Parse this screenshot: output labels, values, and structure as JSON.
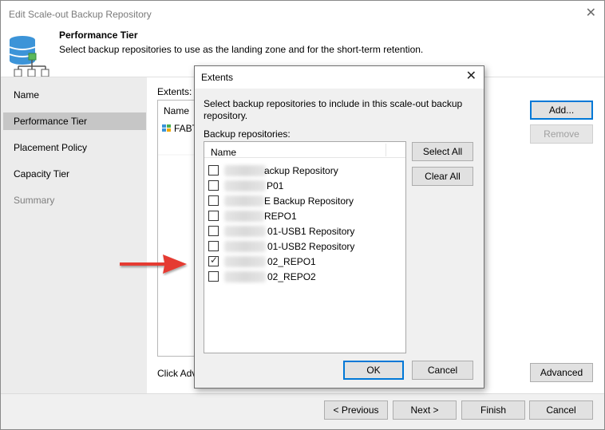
{
  "window": {
    "title": "Edit Scale-out Backup Repository",
    "close_glyph": "✕"
  },
  "header": {
    "title": "Performance Tier",
    "description": "Select backup repositories to use as the landing zone and for the short-term retention.",
    "icon": "database-repository-icon"
  },
  "sidebar": {
    "items": [
      {
        "label": "Name",
        "state": "normal"
      },
      {
        "label": "Performance Tier",
        "state": "active"
      },
      {
        "label": "Placement Policy",
        "state": "normal"
      },
      {
        "label": "Capacity Tier",
        "state": "normal"
      },
      {
        "label": "Summary",
        "state": "disabled"
      }
    ]
  },
  "main": {
    "extents_label": "Extents:",
    "list": {
      "column": "Name",
      "rows": [
        {
          "text": "FABT",
          "icon": "repository-icon"
        }
      ]
    },
    "click_hint": "Click Adv",
    "add_button": "Add...",
    "remove_button": "Remove",
    "advanced_button": "Advanced"
  },
  "footer": {
    "previous": "< Previous",
    "next": "Next >",
    "finish": "Finish",
    "cancel": "Cancel"
  },
  "dialog": {
    "title": "Extents",
    "close_glyph": "✕",
    "description": "Select backup repositories to include in this scale-out backup repository.",
    "label": "Backup repositories:",
    "column": "Name",
    "select_all": "Select All",
    "clear_all": "Clear All",
    "ok": "OK",
    "cancel": "Cancel",
    "repositories": [
      {
        "text": "ackup Repository",
        "checked": false
      },
      {
        "text": "P01",
        "checked": false
      },
      {
        "text": "E Backup Repository",
        "checked": false
      },
      {
        "text": "REPO1",
        "checked": false
      },
      {
        "text": "01-USB1 Repository",
        "checked": false
      },
      {
        "text": "01-USB2 Repository",
        "checked": false
      },
      {
        "text": "02_REPO1",
        "checked": true
      },
      {
        "text": "02_REPO2",
        "checked": false
      }
    ]
  },
  "annotation": {
    "arrow_color": "#e53b30",
    "icon": "red-arrow-icon"
  },
  "colors": {
    "accent": "#0078d7",
    "sidebar_bg": "#ececec",
    "active_item": "#c6c6c6",
    "footer_bg": "#f0f0f0"
  }
}
